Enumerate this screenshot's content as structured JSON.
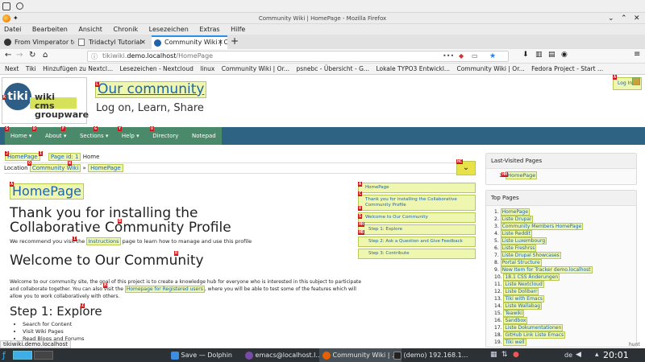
{
  "window": {
    "title": "Community Wiki | HomePage - Mozilla Firefox"
  },
  "menu": [
    "Datei",
    "Bearbeiten",
    "Ansicht",
    "Chronik",
    "Lesezeichen",
    "Extras",
    "Hilfe"
  ],
  "tabs": [
    {
      "label": "From Vimperator to"
    },
    {
      "label": "Tridactyl Tutorial"
    },
    {
      "label": "Community Wiki | C"
    }
  ],
  "address": {
    "url_prefix": "tikiwiki.",
    "url_domain": "demo.localhost",
    "url_path": "/HomePage"
  },
  "bookmarks": [
    "Next",
    "Tiki",
    "Hinzufügen zu Nextcl...",
    "Lesezeichen - Nextcloud",
    "linux",
    "Community Wiki | Or...",
    "psnebc - Übersicht - G...",
    "Lokale TYPO3 Entwickl...",
    "Community Wiki | Or...",
    "Fedora Project - Start ..."
  ],
  "site": {
    "logo_word": "tiki",
    "logo_lines": [
      "wiki",
      "cms",
      "groupware"
    ],
    "title": "Our community",
    "tagline": "Log on, Learn, Share",
    "login": "Log In"
  },
  "nav": [
    "Home",
    "About",
    "Sections",
    "Help",
    "Directory",
    "Notepad"
  ],
  "breadcrumbs": {
    "first": "HomePage",
    "second": "Page id: 1",
    "home": "Home",
    "location_label": "Location",
    "loc1": "Community Wiki",
    "sep": "»",
    "loc2": "HomePage"
  },
  "main": {
    "page_name": "HomePage",
    "h1": "Thank you for installing the Collaborative Community Profile",
    "intro_pre": "We recommend you visit the",
    "intro_link": "Instructions",
    "intro_post": "page to learn how to manage and use this profile",
    "h_welcome": "Welcome to Our Community",
    "welcome_pre": "Welcome to our community site, the goal of this project is to create a knowledge hub for everyone who is interested in this subject to participate and collaborate together. You can also visit the",
    "welcome_link": "Homepage for Registered users",
    "welcome_post": ", where you will be able to test some of the features which will allow you to work collaboratively with others.",
    "h_step1": "Step 1: Explore",
    "step1_items": [
      "Search for Content",
      "Visit Wiki Pages",
      "Read Blogs and Forums"
    ]
  },
  "toc": [
    "HomePage",
    "Thank you for installing the Collaborative Community Profile",
    "Welcome to Our Community",
    "Step 1: Explore",
    "Step 2: Ask a Question and Give Feedback",
    "Step 3: Contribute"
  ],
  "last_visited": {
    "title": "Last-Visited Pages",
    "items": [
      "HomePage"
    ]
  },
  "top_pages": {
    "title": "Top Pages",
    "items": [
      "HomePage",
      "Liste Drupal",
      "Community Members HomePage",
      "Liste Reddit",
      "Liste Luxembourg",
      "Liste Freshrss",
      "Liste Drupal Showcases",
      "Portal Structure",
      "New Item for Tracker demo.localhost",
      "18.1 CSS Änderungen",
      "Liste Nextcloud",
      "Liste Dolibarr",
      "Tiki with Emacs",
      "Liste Wallabag",
      "Teawiki",
      "Sandbox",
      "Liste Dokumentationen",
      "GitHub Link Liste Emacs",
      "Tiki well"
    ]
  },
  "statusbar": "tikiwiki.demo.localhost",
  "hint_label": "hunt",
  "taskbar": {
    "tasks": [
      "Save — Dolphin",
      "emacs@localhost.l...",
      "Community Wiki | ...",
      "(demo) 192.168.1..."
    ],
    "lang": "de",
    "time": "20:01"
  },
  "colors": {
    "header_bar": "#2e6383",
    "nav_green": "#4a8a6a",
    "hint_red": "#c81a1a",
    "highlight": "#eef6b0",
    "link": "#1f64a8"
  }
}
